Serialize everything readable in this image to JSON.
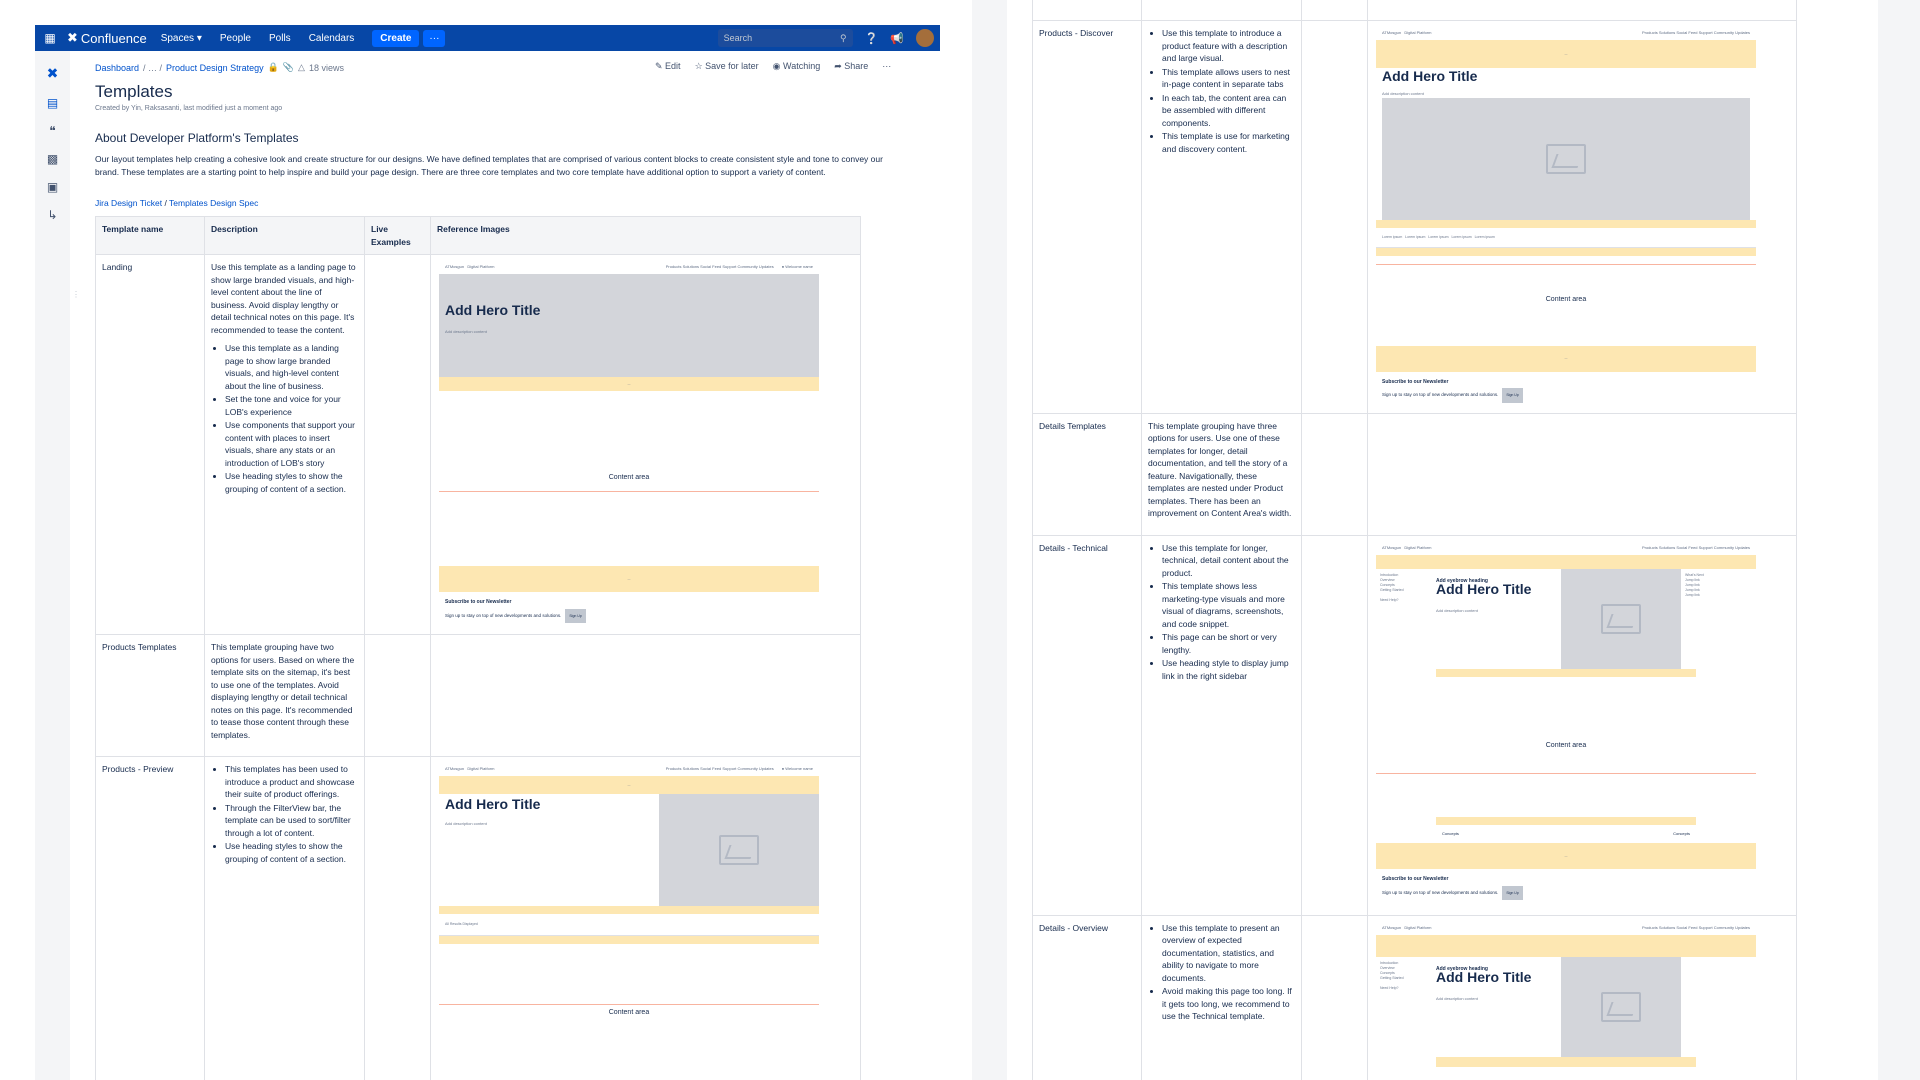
{
  "nav": {
    "app_name": "Confluence",
    "spaces": "Spaces",
    "people": "People",
    "polls": "Polls",
    "calendars": "Calendars",
    "create": "Create",
    "more": "···",
    "search_placeholder": "Search"
  },
  "breadcrumb": {
    "dashboard": "Dashboard",
    "ellipsis": "/ … /",
    "space": "Product Design Strategy",
    "views": "18 views"
  },
  "actions": {
    "edit": "Edit",
    "save": "Save for later",
    "watching": "Watching",
    "share": "Share",
    "more": "···"
  },
  "page": {
    "title": "Templates",
    "byline": "Created by Yin, Raksasanti, last modified just a moment ago",
    "heading": "About Developer Platform's Templates",
    "intro": "Our layout templates help creating a cohesive look and create structure for our designs. We have defined templates that are comprised of various content blocks to create consistent style and tone to convey our brand. These templates are a starting point to help inspire and build your page design. There are three core templates and two core template have additional option to support a variety of content.",
    "link1": "Jira Design Ticket",
    "link_sep": " / ",
    "link2": "Templates Design Spec"
  },
  "table": {
    "headers": [
      "Template name",
      "Description",
      "Live Examples",
      "Reference Images"
    ],
    "landing": {
      "name": "Landing",
      "intro": "Use this template as a landing page to show large branded visuals, and high-level content about the line of business. Avoid display lengthy or detail technical notes on this page. It's recommended to tease the content.",
      "bullets": [
        "Use this template as a landing page to show large branded visuals, and high-level content about the line of business.",
        "Set the tone and voice for your LOB's experience",
        "Use components that support your content with places to insert visuals, share any stats or an introduction of LOB's story",
        "Use heading styles to show the grouping of content of a section."
      ]
    },
    "products": {
      "name": "Products Templates",
      "desc": "This template grouping have two options for users. Based on where the template sits on the sitemap, it's best to use one of the templates. Avoid displaying lengthy or detail technical notes on this page. It's recommended to tease those content through these templates."
    },
    "preview": {
      "name": "Products - Preview",
      "bullets": [
        "This templates has been used to introduce a product and showcase their suite of product offerings.",
        "Through the FilterView bar, the template can be used to sort/filter through a lot of content.",
        "Use heading styles to show the grouping of content of a section."
      ]
    },
    "discover": {
      "name": "Products - Discover",
      "bullets": [
        "Use this template to introduce a product feature with a description and large visual.",
        "This template allows users to nest in-page content in separate tabs",
        "In each tab, the content area can be assembled with different components.",
        "This template is use for marketing and discovery content."
      ]
    },
    "details": {
      "name": "Details Templates",
      "desc": "This template grouping have three options for users. Use one of these templates for longer, detail documentation, and tell the story of a feature. Navigationally, these templates are nested under Product templates. There has been an improvement on Content Area's width."
    },
    "technical": {
      "name": "Details - Technical",
      "bullets": [
        "Use this template for longer, technical, detail content about the product.",
        "This template shows less marketing-type visuals and more visual of diagrams, screenshots, and code snippet.",
        "This page can be short or very lengthy.",
        "Use heading style to display jump link in the right sidebar"
      ]
    },
    "overview": {
      "name": "Details - Overview",
      "bullets": [
        "Use this template to present an overview of expected documentation, statistics, and ability to navigate to more documents.",
        "Avoid making this page too long. If it gets too long, we recommend to use the Technical template."
      ]
    }
  },
  "thumb": {
    "hero_title": "Add Hero Title",
    "hero_sub": "Add description content",
    "content_area": "Content area",
    "newsletter_title": "Subscribe to our Newsletter",
    "newsletter_sub": "Sign up to stay on top of new developments and solutions.",
    "eyebrow": "Add eyebrow heading",
    "concepts": "Concepts"
  },
  "colors": {
    "nav_bg": "#0747a6",
    "link": "#0052cc",
    "band": "#fde7b2",
    "placeholder": "#d3d5da"
  }
}
